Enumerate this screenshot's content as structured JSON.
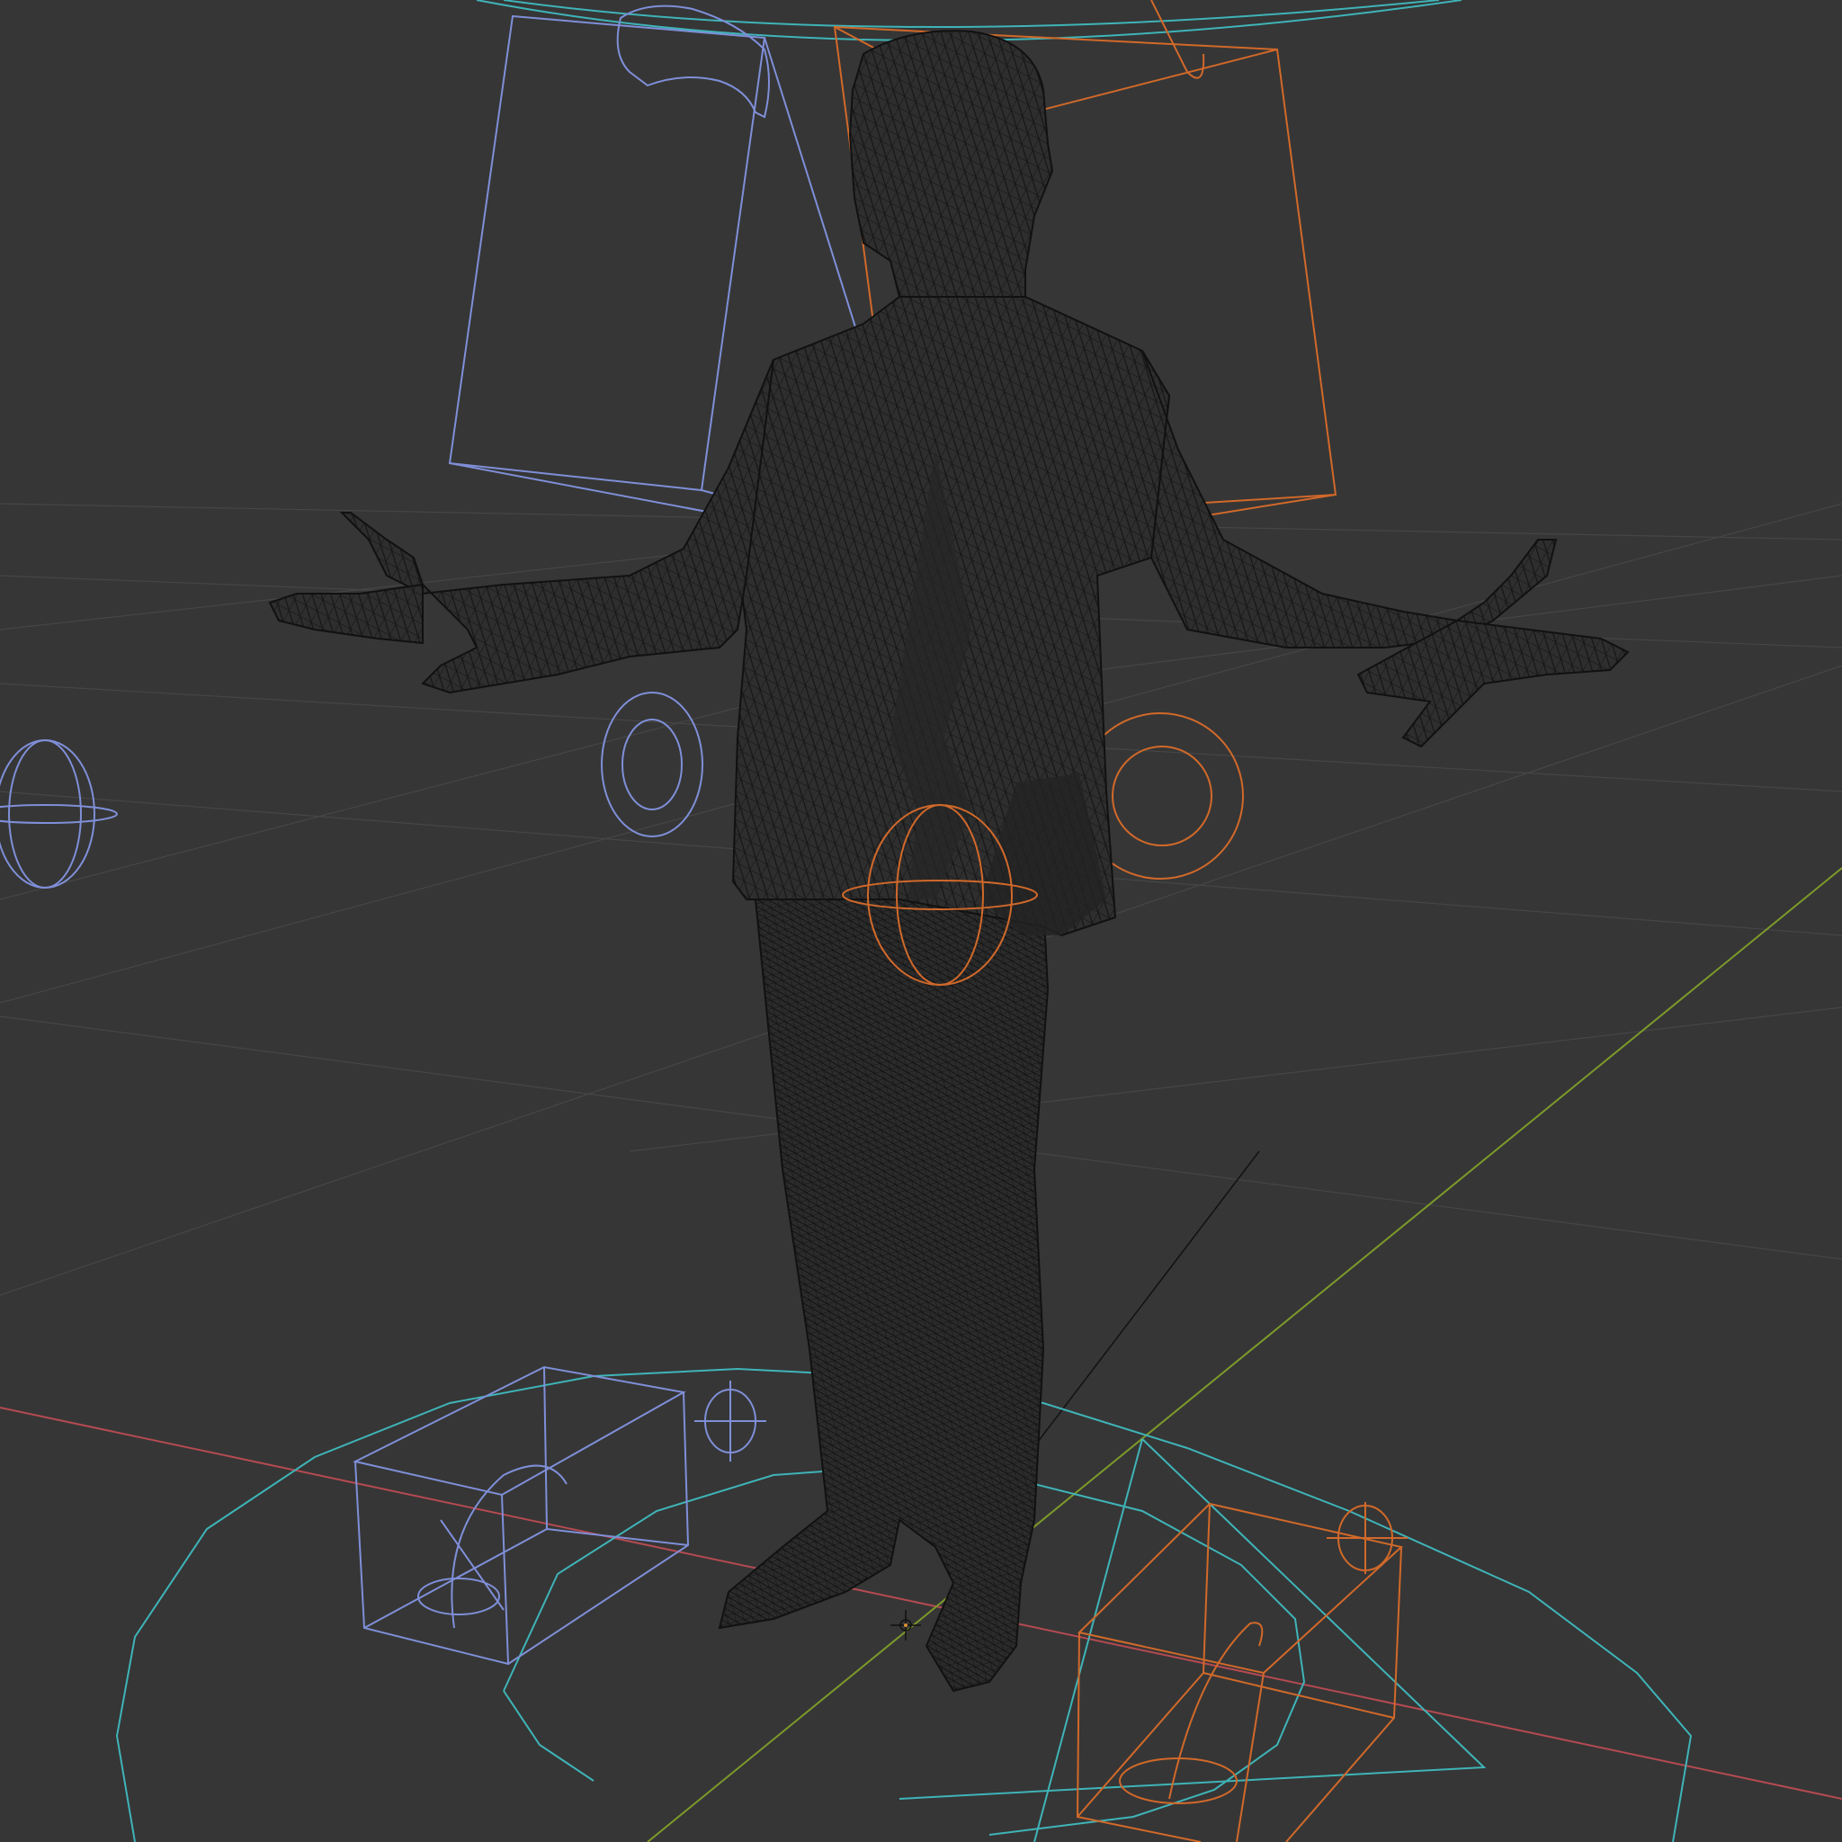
{
  "app": "3D viewport",
  "viewport": {
    "shading": "wireframe",
    "background": "#363636"
  },
  "colors": {
    "grid": "#4a4a4a",
    "x_axis": "#b54a52",
    "y_axis": "#7d9a2a",
    "mesh_fill": "#2c2c2c",
    "mesh_wire": "#151515",
    "bone_blue": "#7f8fd8",
    "bone_orange": "#d1692a",
    "control_cyan": "#3fb4b8"
  },
  "scene": {
    "objects": [
      {
        "name": "character-mesh",
        "type": "mesh"
      },
      {
        "name": "control-box-blue-head",
        "type": "bone-shape"
      },
      {
        "name": "control-box-orange-head",
        "type": "bone-shape"
      },
      {
        "name": "control-circle-blue-hip",
        "type": "bone-shape"
      },
      {
        "name": "control-circle-orange-hip",
        "type": "bone-shape"
      },
      {
        "name": "control-sphere-blue",
        "type": "bone-shape"
      },
      {
        "name": "control-sphere-orange",
        "type": "bone-shape"
      },
      {
        "name": "control-root-circle",
        "type": "bone-shape"
      },
      {
        "name": "foot-box-blue",
        "type": "bone-shape"
      },
      {
        "name": "foot-box-orange",
        "type": "bone-shape"
      }
    ]
  }
}
